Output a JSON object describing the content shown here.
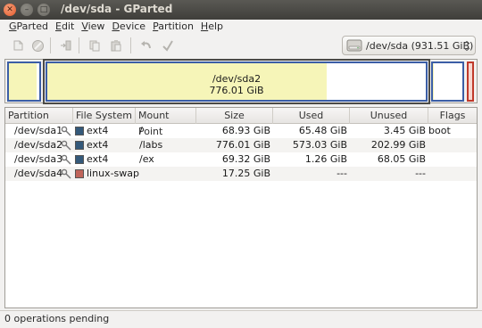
{
  "window": {
    "title": "/dev/sda - GParted"
  },
  "menubar": {
    "items": [
      {
        "label": "GParted",
        "mnemonic": "G",
        "rest": "Parted"
      },
      {
        "label": "Edit",
        "mnemonic": "E",
        "rest": "dit"
      },
      {
        "label": "View",
        "mnemonic": "V",
        "rest": "iew"
      },
      {
        "label": "Device",
        "mnemonic": "D",
        "rest": "evice"
      },
      {
        "label": "Partition",
        "mnemonic": "P",
        "rest": "artition"
      },
      {
        "label": "Help",
        "mnemonic": "H",
        "rest": "elp"
      }
    ]
  },
  "toolbar": {
    "buttons": [
      "new-partition-icon",
      "delete-icon",
      "resize-move-icon",
      "copy-icon",
      "paste-icon",
      "undo-icon",
      "apply-icon"
    ]
  },
  "device_selector": {
    "label": "/dev/sda  (931.51 GiB)"
  },
  "diskmap": {
    "selected_name": "/dev/sda2",
    "selected_size": "776.01 GiB"
  },
  "table": {
    "headers": {
      "partition": "Partition",
      "filesystem": "File System",
      "mountpoint": "Mount Point",
      "size": "Size",
      "used": "Used",
      "unused": "Unused",
      "flags": "Flags"
    },
    "rows": [
      {
        "partition": "/dev/sda1",
        "filesystem": "ext4",
        "fs_color": "#34597a",
        "mountpoint": "/",
        "size": "68.93 GiB",
        "used": "65.48 GiB",
        "unused": "3.45 GiB",
        "flags": "boot"
      },
      {
        "partition": "/dev/sda2",
        "filesystem": "ext4",
        "fs_color": "#34597a",
        "mountpoint": "/labs",
        "size": "776.01 GiB",
        "used": "573.03 GiB",
        "unused": "202.99 GiB",
        "flags": ""
      },
      {
        "partition": "/dev/sda3",
        "filesystem": "ext4",
        "fs_color": "#34597a",
        "mountpoint": "/ex",
        "size": "69.32 GiB",
        "used": "1.26 GiB",
        "unused": "68.05 GiB",
        "flags": ""
      },
      {
        "partition": "/dev/sda4",
        "filesystem": "linux-swap",
        "fs_color": "#c0645a",
        "mountpoint": "",
        "size": "17.25 GiB",
        "used": "---",
        "unused": "---",
        "flags": ""
      }
    ]
  },
  "status": {
    "text": "0 operations pending"
  },
  "colors": {
    "partition_border": "#3b5ea6",
    "used_fill": "#f6f5b8",
    "swap_border": "#c0392b"
  }
}
